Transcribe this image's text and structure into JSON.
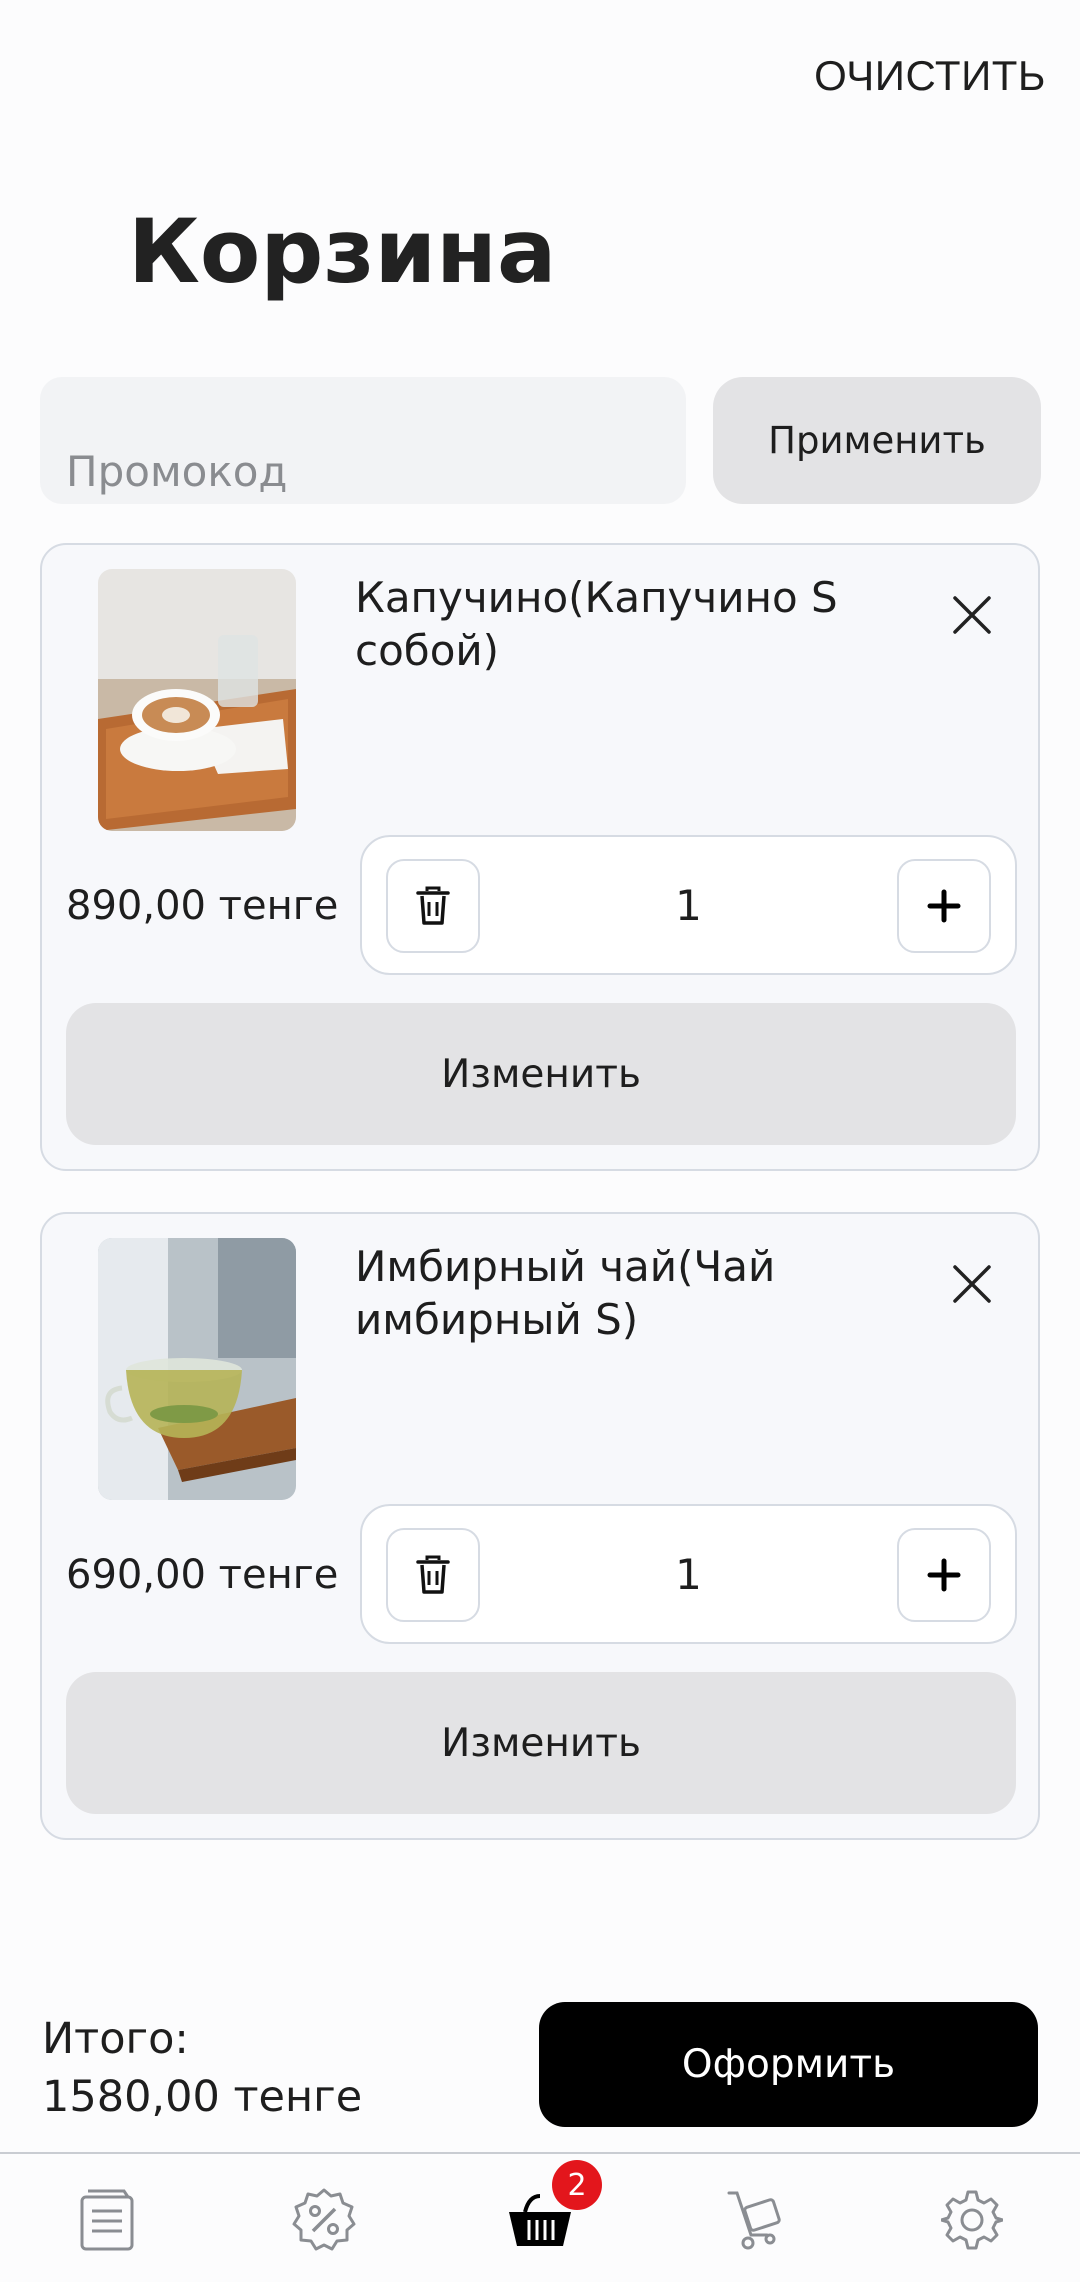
{
  "header": {
    "clear_label": "ОЧИСТИТЬ",
    "title": "Корзина"
  },
  "promo": {
    "placeholder": "Промокод",
    "apply_label": "Применить"
  },
  "cart": {
    "items": [
      {
        "name": "Капучино(Капучино S собой)",
        "price": "890,00 тенге",
        "quantity": "1",
        "edit_label": "Изменить"
      },
      {
        "name": "Имбирный чай(Чай имбирный S)",
        "price": "690,00 тенге",
        "quantity": "1",
        "edit_label": "Изменить"
      }
    ]
  },
  "summary": {
    "total_label": "Итого:",
    "total_value": "1580,00 тенге",
    "checkout_label": "Оформить"
  },
  "tabbar": {
    "items": [
      {
        "icon": "menu-icon"
      },
      {
        "icon": "discount-icon"
      },
      {
        "icon": "basket-icon",
        "active": true,
        "badge": "2"
      },
      {
        "icon": "delivery-cart-icon"
      },
      {
        "icon": "settings-icon"
      }
    ]
  },
  "colors": {
    "accent": "#000000",
    "badge": "#e3161c",
    "button_bg": "#e3e3e5",
    "card_bg": "#f7f8fb"
  }
}
